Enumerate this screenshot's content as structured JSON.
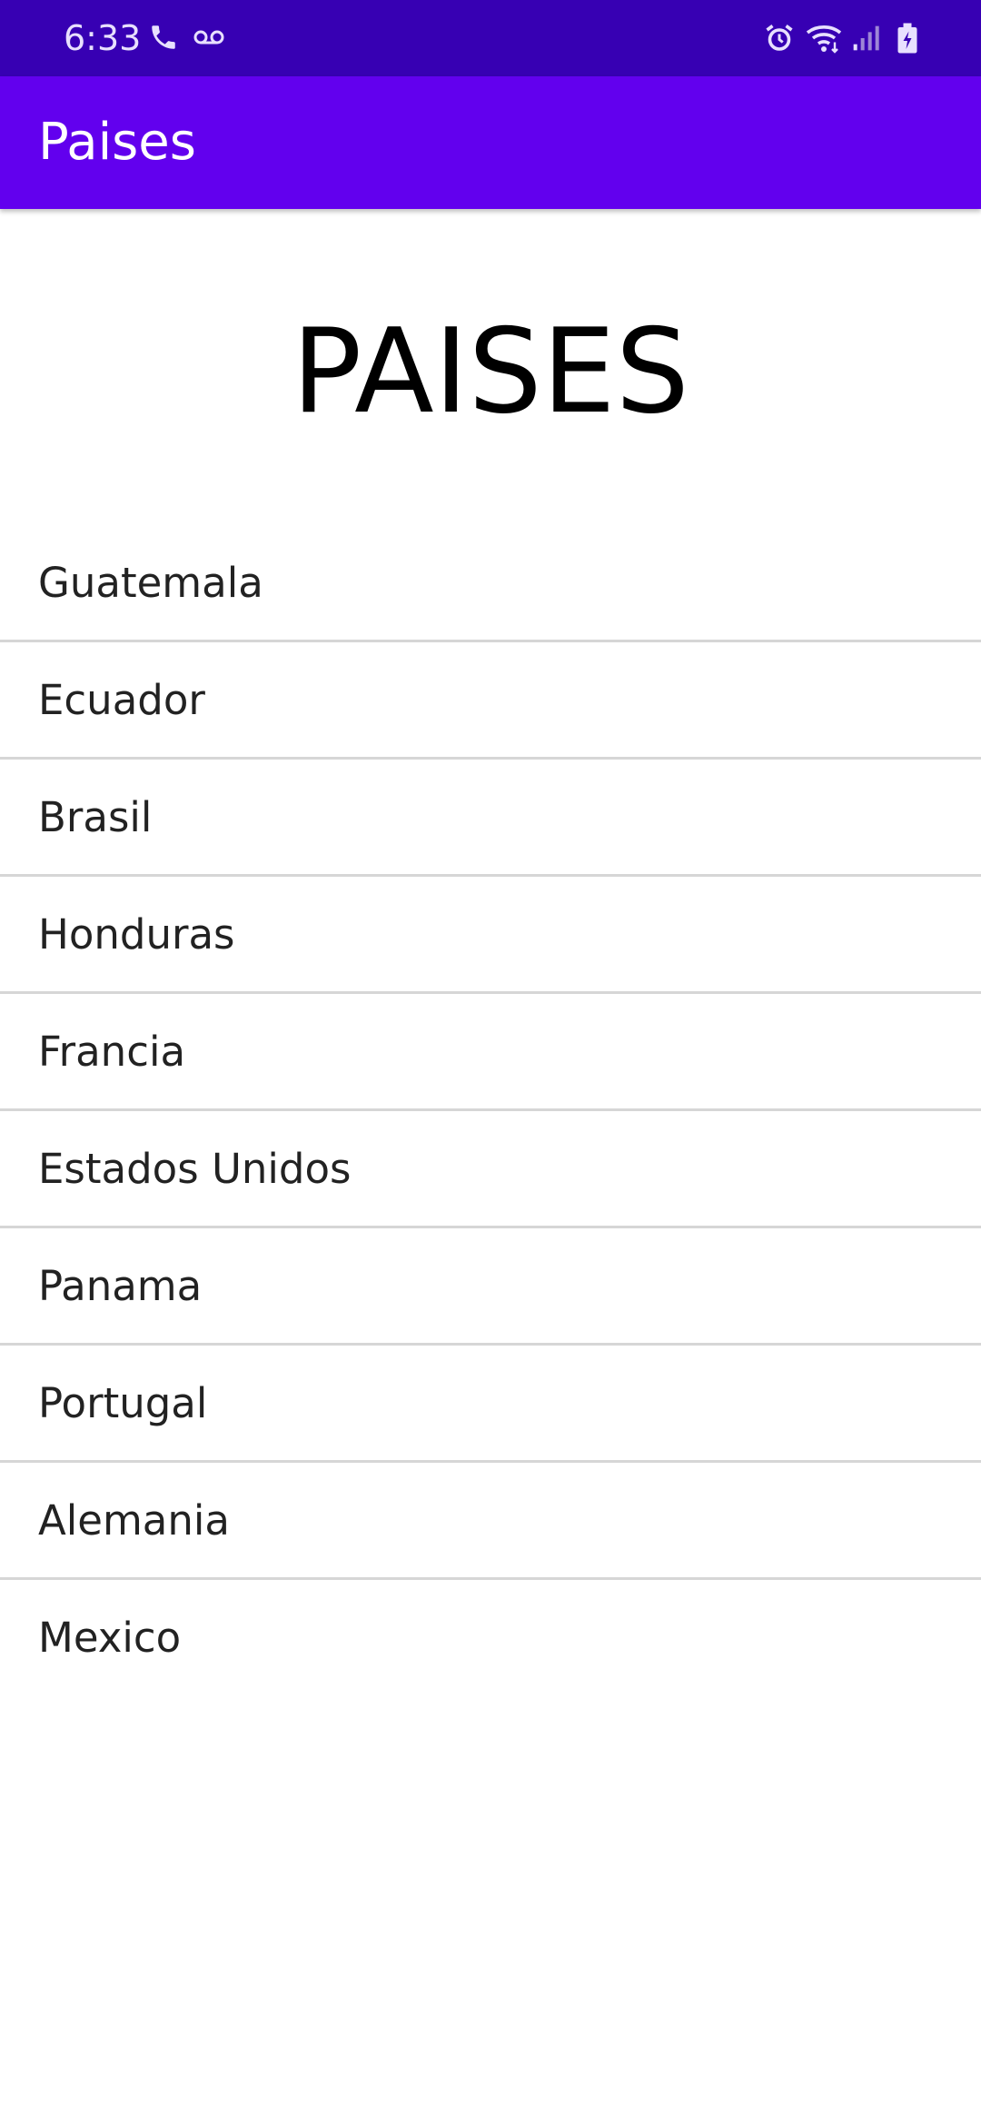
{
  "status_bar": {
    "time": "6:33",
    "left_icons": [
      "phone-icon",
      "voicemail-icon"
    ],
    "right_icons": [
      "alarm-icon",
      "wifi-icon",
      "signal-icon",
      "battery-charging-icon"
    ],
    "background": "#3700b3"
  },
  "app_bar": {
    "title": "Paises",
    "background": "#6200ee"
  },
  "main": {
    "heading": "PAISES",
    "countries": [
      {
        "label": "Guatemala"
      },
      {
        "label": "Ecuador"
      },
      {
        "label": "Brasil"
      },
      {
        "label": "Honduras"
      },
      {
        "label": "Francia"
      },
      {
        "label": "Estados Unidos"
      },
      {
        "label": "Panama"
      },
      {
        "label": "Portugal"
      },
      {
        "label": "Alemania"
      },
      {
        "label": "Mexico"
      }
    ]
  }
}
